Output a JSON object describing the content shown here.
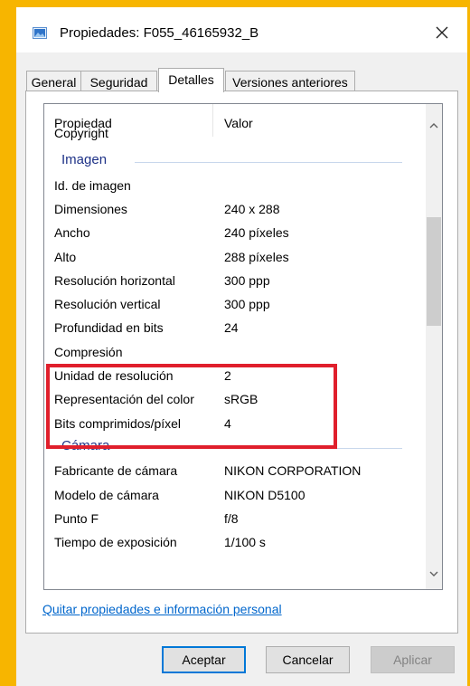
{
  "window": {
    "title": "Propiedades: F055_46165932_B",
    "close_label": "✕"
  },
  "tabs": [
    {
      "label": "General"
    },
    {
      "label": "Seguridad"
    },
    {
      "label": "Detalles",
      "active": true
    },
    {
      "label": "Versiones anteriores"
    }
  ],
  "table": {
    "header": {
      "property": "Propiedad",
      "value": "Valor"
    },
    "rows": [
      {
        "k": "Copyright",
        "v": ""
      },
      {
        "group": "Imagen"
      },
      {
        "k": "Id. de imagen",
        "v": ""
      },
      {
        "k": "Dimensiones",
        "v": "240 x 288"
      },
      {
        "k": "Ancho",
        "v": "240 píxeles"
      },
      {
        "k": "Alto",
        "v": "288 píxeles"
      },
      {
        "k": "Resolución horizontal",
        "v": "300 ppp"
      },
      {
        "k": "Resolución vertical",
        "v": "300 ppp"
      },
      {
        "k": "Profundidad en bits",
        "v": "24"
      },
      {
        "k": "Compresión",
        "v": ""
      },
      {
        "k": "Unidad de resolución",
        "v": "2"
      },
      {
        "k": "Representación del color",
        "v": "sRGB"
      },
      {
        "k": "Bits comprimidos/píxel",
        "v": "4"
      },
      {
        "group": "Cámara"
      },
      {
        "k": "Fabricante de cámara",
        "v": "NIKON CORPORATION"
      },
      {
        "k": "Modelo de cámara",
        "v": "NIKON D5100"
      },
      {
        "k": "Punto F",
        "v": "f/8"
      },
      {
        "k": "Tiempo de exposición",
        "v": "1/100 s"
      }
    ]
  },
  "scroll": {
    "up_icon": "^",
    "down_icon": "v"
  },
  "link_text": "Quitar propiedades e información personal",
  "buttons": {
    "ok": "Aceptar",
    "cancel": "Cancelar",
    "apply": "Aplicar"
  },
  "colors": {
    "highlight": "#e01f2c",
    "frame": "#f7b500",
    "link": "#0066cc"
  }
}
